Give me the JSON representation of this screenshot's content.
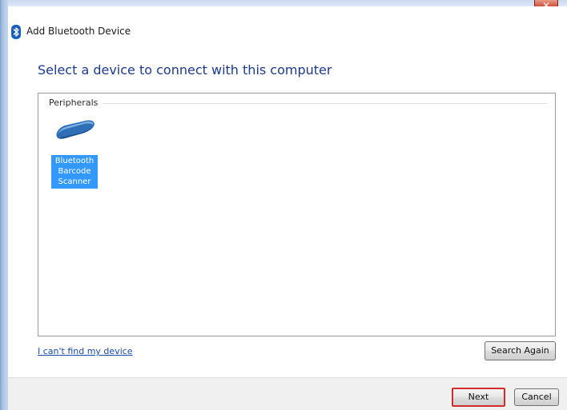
{
  "window": {
    "title": "Add Bluetooth Device",
    "close_glyph": "✕"
  },
  "main": {
    "instruction": "Select a device to connect with this computer",
    "group_label": "Peripherals",
    "devices": [
      {
        "label": "Bluetooth\nBarcode\nScanner",
        "icon": "barcode-scanner-icon",
        "selected": true
      }
    ],
    "cant_find_link": "I can't find my device",
    "search_again_label": "Search Again"
  },
  "footer": {
    "next_label": "Next",
    "cancel_label": "Cancel"
  },
  "colors": {
    "accent_blue": "#3399ff",
    "instruction_text": "#1e3a8a",
    "highlight_border": "#d32a2a"
  }
}
